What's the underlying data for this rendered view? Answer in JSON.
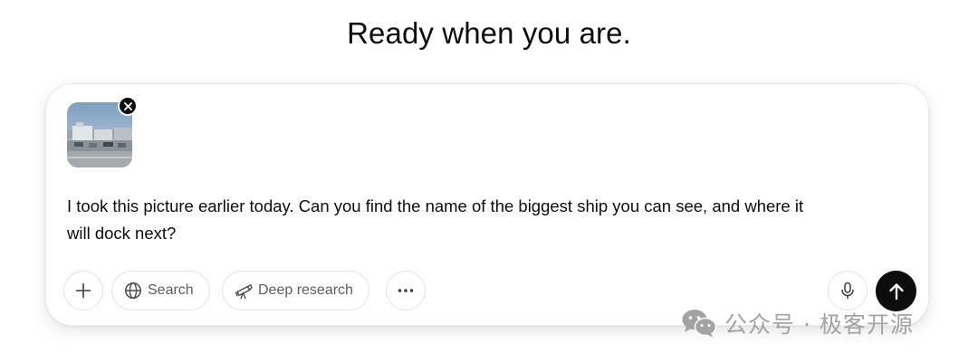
{
  "headline": "Ready when you are.",
  "composer": {
    "attachment": {
      "kind": "image",
      "remove_icon": "close-icon"
    },
    "prompt_text": "I took this picture earlier today. Can you find the name of the biggest ship you can see, and where it will dock next?",
    "toolbar": {
      "add_icon": "plus-icon",
      "search_label": "Search",
      "search_icon": "globe-icon",
      "deep_research_label": "Deep research",
      "deep_research_icon": "telescope-icon",
      "more_icon": "ellipsis-icon",
      "mic_icon": "microphone-icon",
      "send_icon": "arrow-up-icon"
    }
  },
  "watermark": {
    "text": "公众号 · 极客开源",
    "icon": "wechat-icon"
  },
  "colors": {
    "send_button": "#0d0d0d",
    "toolbar_text": "#5d5d5d",
    "border": "#e3e3e3",
    "watermark": "#a3a3a3"
  }
}
